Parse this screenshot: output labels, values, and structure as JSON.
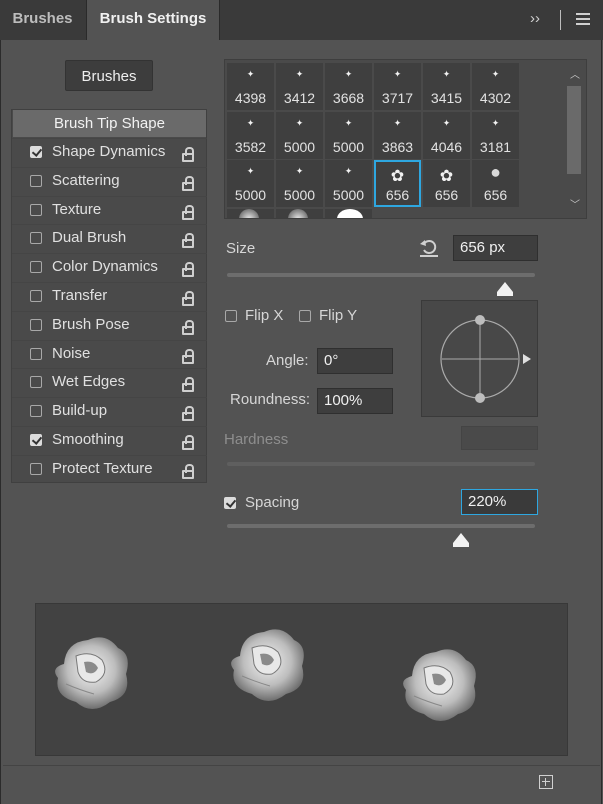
{
  "tabs": [
    {
      "label": "Brushes",
      "active": false
    },
    {
      "label": "Brush Settings",
      "active": true
    }
  ],
  "header_icons": [
    "double-chevron-right-icon",
    "separator",
    "hamburger-menu-icon"
  ],
  "brushes_button_label": "Brushes",
  "options": {
    "tip_shape_label": "Brush Tip Shape",
    "items": [
      {
        "label": "Shape Dynamics",
        "checked": true
      },
      {
        "label": "Scattering",
        "checked": false
      },
      {
        "label": "Texture",
        "checked": false
      },
      {
        "label": "Dual Brush",
        "checked": false
      },
      {
        "label": "Color Dynamics",
        "checked": false
      },
      {
        "label": "Transfer",
        "checked": false
      },
      {
        "label": "Brush Pose",
        "checked": false
      },
      {
        "label": "Noise",
        "checked": false
      },
      {
        "label": "Wet Edges",
        "checked": false
      },
      {
        "label": "Build-up",
        "checked": false
      },
      {
        "label": "Smoothing",
        "checked": true
      },
      {
        "label": "Protect Texture",
        "checked": false
      }
    ]
  },
  "brush_grid": {
    "sizes": [
      "4398",
      "3412",
      "3668",
      "3717",
      "3415",
      "4302",
      "3582",
      "5000",
      "5000",
      "3863",
      "4046",
      "3181",
      "5000",
      "5000",
      "5000",
      "656",
      "656",
      "656"
    ],
    "selected_index": 15
  },
  "size": {
    "label": "Size",
    "value": "656 px",
    "slider_fraction": 0.88
  },
  "flip_x_label": "Flip X",
  "flip_y_label": "Flip Y",
  "angle": {
    "label": "Angle:",
    "value": "0°"
  },
  "roundness": {
    "label": "Roundness:",
    "value": "100%"
  },
  "hardness": {
    "label": "Hardness",
    "value": ""
  },
  "spacing": {
    "label": "Spacing",
    "checked": true,
    "value": "220%",
    "slider_fraction": 0.72
  },
  "colors": {
    "selection": "#2ea7e0",
    "panel": "#535353"
  }
}
